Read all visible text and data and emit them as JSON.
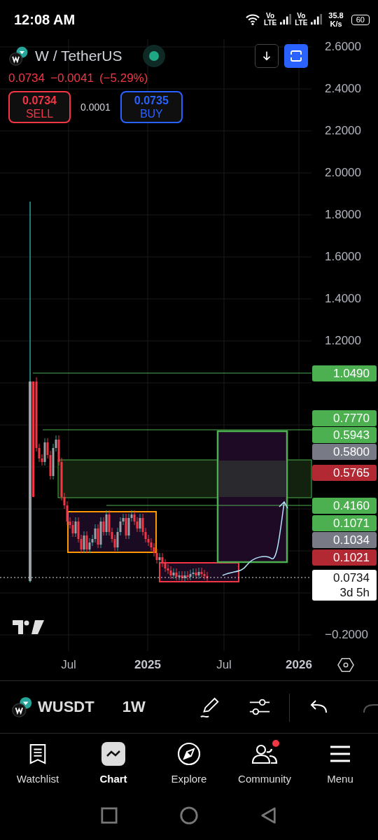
{
  "status_bar": {
    "time": "12:08 AM",
    "networks": [
      {
        "top": "Vo",
        "bottom": "LTE"
      },
      {
        "top": "Vo",
        "bottom": "LTE"
      }
    ],
    "speed": {
      "value": "35.8",
      "unit": "K/s"
    },
    "battery": "60"
  },
  "header": {
    "symbol": "W / TetherUS",
    "price": "0.0734",
    "change": "−0.0041",
    "change_percent": "(−5.29%)",
    "sell": {
      "price": "0.0734",
      "label": "SELL"
    },
    "spread": "0.0001",
    "buy": {
      "price": "0.0735",
      "label": "BUY"
    }
  },
  "price_axis": {
    "upper": [
      "2.6000",
      "2.4000",
      "2.2000",
      "2.0000",
      "1.8000",
      "1.6000",
      "1.4000",
      "1.2000"
    ],
    "lower": [
      "−0.2000"
    ]
  },
  "price_tags": [
    {
      "label": "1.0490",
      "color": "#4caf50"
    },
    {
      "label": "0.7770",
      "color": "#4caf50"
    },
    {
      "label": "0.5943",
      "color": "#4caf50"
    },
    {
      "label": "0.5800",
      "color": "#787b86"
    },
    {
      "label": "0.5765",
      "color": "#b22833"
    },
    {
      "label": "0.4160",
      "color": "#4caf50"
    },
    {
      "label": "0.1071",
      "color": "#4caf50"
    },
    {
      "label": "0.1034",
      "color": "#787b86"
    },
    {
      "label": "0.1021",
      "color": "#b22833"
    }
  ],
  "current_price": {
    "label": "0.0734",
    "countdown": "3d 5h"
  },
  "time_axis": [
    {
      "label": "Jul",
      "kind": "month"
    },
    {
      "label": "2025",
      "kind": "year"
    },
    {
      "label": "Jul",
      "kind": "month"
    },
    {
      "label": "2026",
      "kind": "year"
    }
  ],
  "toolbar": {
    "symbol": "WUSDT",
    "interval": "1W"
  },
  "nav": [
    {
      "label": "Watchlist",
      "selected": false,
      "notification": false
    },
    {
      "label": "Chart",
      "selected": true,
      "notification": false
    },
    {
      "label": "Explore",
      "selected": false,
      "notification": false
    },
    {
      "label": "Community",
      "selected": false,
      "notification": true
    },
    {
      "label": "Menu",
      "selected": false,
      "notification": false
    }
  ]
}
